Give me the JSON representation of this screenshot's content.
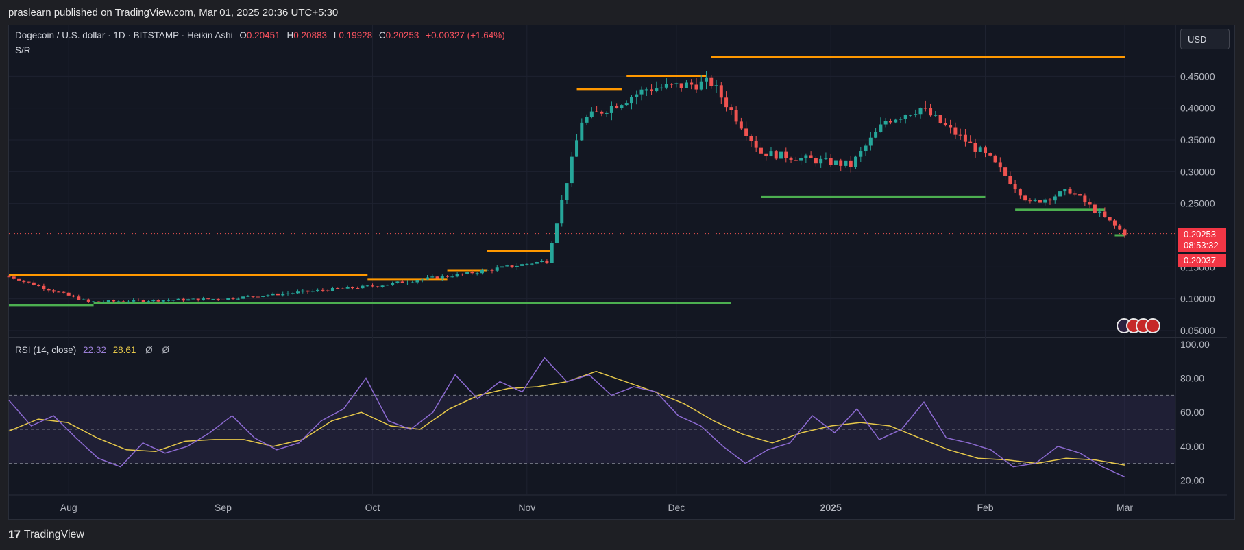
{
  "header": {
    "published_text": "praslearn published on TradingView.com, Mar 01, 2025 20:36 UTC+5:30"
  },
  "legend": {
    "symbol": "Dogecoin / U.S. dollar · 1D · BITSTAMP · Heikin Ashi",
    "open_label": "O",
    "open": "0.20451",
    "high_label": "H",
    "high": "0.20883",
    "low_label": "L",
    "low": "0.19928",
    "close_label": "C",
    "close": "0.20253",
    "change": "+0.00327 (+1.64%)",
    "indicator": "S/R"
  },
  "rsi_legend": {
    "title": "RSI (14, close)",
    "rsi_value": "22.32",
    "ma_value": "28.61",
    "icon_a": "Ø",
    "icon_b": "Ø"
  },
  "currency_button": "USD",
  "price_badge": {
    "price": "0.20253",
    "countdown": "08:53:32",
    "low_price": "0.20037"
  },
  "footer": {
    "logo_mark": "17",
    "brand": "TradingView"
  },
  "colors": {
    "bull": "#26a69a",
    "bear": "#ef5350",
    "resistance": "#ff9800",
    "support": "#4caf50",
    "rsi": "#8c6ad1",
    "rsi_ma": "#e6c84a",
    "background": "#131722"
  },
  "flag_icons": [
    "crypto-icon",
    "us-flag-icon",
    "us-flag-icon",
    "us-flag-icon"
  ],
  "chart_data": [
    {
      "type": "candlestick",
      "title": "Dogecoin / U.S. dollar · 1D · BITSTAMP · Heikin Ashi",
      "price_axis_ticks": [
        "0.45000",
        "0.40000",
        "0.35000",
        "0.30000",
        "0.25000",
        "0.15000",
        "0.10000",
        "0.05000"
      ],
      "time_axis_ticks": [
        "Aug",
        "Sep",
        "Oct",
        "Nov",
        "Dec",
        "2025",
        "Feb",
        "Mar"
      ],
      "ylim": [
        0.04,
        0.5
      ],
      "grid": true,
      "key_points": [
        {
          "date": "2024-07-20",
          "close": 0.135
        },
        {
          "date": "2024-08-05",
          "close": 0.095
        },
        {
          "date": "2024-09-01",
          "close": 0.1
        },
        {
          "date": "2024-10-01",
          "close": 0.12
        },
        {
          "date": "2024-10-20",
          "close": 0.14
        },
        {
          "date": "2024-11-05",
          "close": 0.16
        },
        {
          "date": "2024-11-12",
          "close": 0.38
        },
        {
          "date": "2024-11-25",
          "close": 0.43
        },
        {
          "date": "2024-12-08",
          "close": 0.44
        },
        {
          "date": "2024-12-18",
          "close": 0.33
        },
        {
          "date": "2025-01-05",
          "close": 0.31
        },
        {
          "date": "2025-01-12",
          "close": 0.38
        },
        {
          "date": "2025-01-19",
          "close": 0.4
        },
        {
          "date": "2025-02-02",
          "close": 0.32
        },
        {
          "date": "2025-02-10",
          "close": 0.25
        },
        {
          "date": "2025-02-18",
          "close": 0.27
        },
        {
          "date": "2025-03-01",
          "close": 0.20253
        }
      ],
      "support_resistance": [
        {
          "kind": "resistance",
          "level": 0.137
        },
        {
          "kind": "resistance",
          "level": 0.13
        },
        {
          "kind": "resistance",
          "level": 0.145
        },
        {
          "kind": "resistance",
          "level": 0.175
        },
        {
          "kind": "resistance",
          "level": 0.43
        },
        {
          "kind": "resistance",
          "level": 0.45
        },
        {
          "kind": "resistance",
          "level": 0.48
        },
        {
          "kind": "support",
          "level": 0.09
        },
        {
          "kind": "support",
          "level": 0.093
        },
        {
          "kind": "support",
          "level": 0.26
        },
        {
          "kind": "support",
          "level": 0.24
        },
        {
          "kind": "support",
          "level": 0.2
        }
      ]
    },
    {
      "type": "line",
      "title": "RSI (14, close)",
      "y_axis_ticks": [
        "100.00",
        "80.00",
        "60.00",
        "40.00",
        "20.00"
      ],
      "ylim": [
        15,
        100
      ],
      "bands": [
        30,
        50,
        70
      ],
      "series": [
        {
          "name": "RSI",
          "values": [
            67,
            52,
            58,
            45,
            33,
            28,
            42,
            36,
            40,
            48,
            58,
            45,
            38,
            42,
            55,
            62,
            80,
            55,
            50,
            60,
            82,
            68,
            78,
            72,
            92,
            78,
            82,
            70,
            75,
            72,
            58,
            52,
            40,
            30,
            38,
            42,
            58,
            48,
            62,
            44,
            50,
            66,
            45,
            42,
            38,
            28,
            30,
            40,
            36,
            28,
            22
          ]
        },
        {
          "name": "RSI-based MA",
          "values": [
            49,
            56,
            54,
            45,
            38,
            37,
            43,
            44,
            44,
            40,
            44,
            55,
            60,
            52,
            50,
            62,
            70,
            74,
            75,
            78,
            84,
            78,
            72,
            65,
            55,
            47,
            42,
            48,
            52,
            54,
            52,
            45,
            38,
            33,
            32,
            30,
            33,
            32,
            29
          ]
        }
      ]
    }
  ]
}
